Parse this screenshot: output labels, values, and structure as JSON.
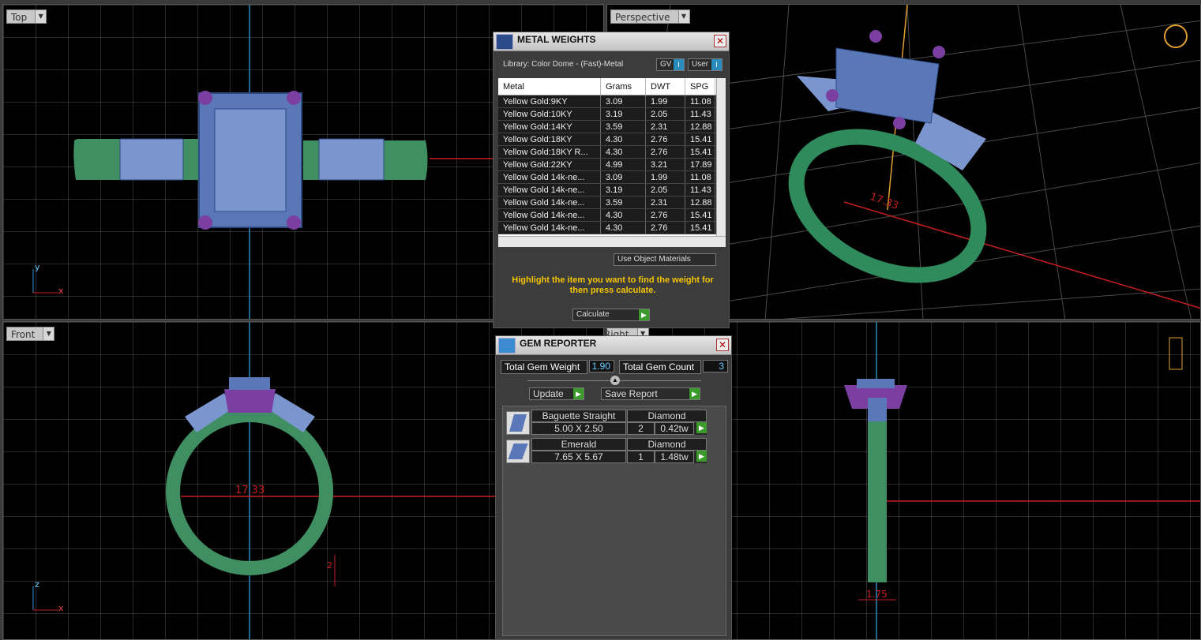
{
  "viewports": {
    "top": {
      "label": "Top",
      "axis_a": "y",
      "axis_b": "x"
    },
    "perspective": {
      "label": "Perspective",
      "dimension": "17.33"
    },
    "front": {
      "label": "Front",
      "axis_a": "z",
      "axis_b": "x",
      "dimension": "17.33",
      "dimension_small": "2"
    },
    "right": {
      "label": "Right",
      "dimension": "1.75"
    }
  },
  "metal_weights": {
    "title": "METAL WEIGHTS",
    "library": "Library: Color Dome - (Fast)-Metal",
    "gv_label": "GV",
    "user_label": "User",
    "columns": [
      "Metal",
      "Grams",
      "DWT",
      "SPG"
    ],
    "rows": [
      [
        "Yellow Gold:9KY",
        "3.09",
        "1.99",
        "11.08"
      ],
      [
        "Yellow Gold:10KY",
        "3.19",
        "2.05",
        "11.43"
      ],
      [
        "Yellow Gold:14KY",
        "3.59",
        "2.31",
        "12.88"
      ],
      [
        "Yellow Gold:18KY",
        "4.30",
        "2.76",
        "15.41"
      ],
      [
        "Yellow Gold:18KY R...",
        "4.30",
        "2.76",
        "15.41"
      ],
      [
        "Yellow Gold:22KY",
        "4.99",
        "3.21",
        "17.89"
      ],
      [
        "Yellow Gold 14k-ne...",
        "3.09",
        "1.99",
        "11.08"
      ],
      [
        "Yellow Gold 14k-ne...",
        "3.19",
        "2.05",
        "11.43"
      ],
      [
        "Yellow Gold 14k-ne...",
        "3.59",
        "2.31",
        "12.88"
      ],
      [
        "Yellow Gold 14k-ne...",
        "4.30",
        "2.76",
        "15.41"
      ],
      [
        "Yellow Gold 14k-ne...",
        "4.30",
        "2.76",
        "15.41"
      ]
    ],
    "use_object_materials": "Use Object Materials",
    "instruction": "Highlight the item you want to find the weight for then press calculate.",
    "calculate": "Calculate"
  },
  "gem_reporter": {
    "title": "GEM REPORTER",
    "total_weight_label": "Total Gem Weight",
    "total_weight": "1.90",
    "total_count_label": "Total Gem Count",
    "total_count": "3",
    "update": "Update",
    "save_report": "Save Report",
    "gems": [
      {
        "shape": "Baguette Straight",
        "material": "Diamond",
        "size": "5.00 X 2.50",
        "qty": "2",
        "weight": "0.42tw"
      },
      {
        "shape": "Emerald",
        "material": "Diamond",
        "size": "7.65 X 5.67",
        "qty": "1",
        "weight": "1.48tw"
      }
    ]
  },
  "colors": {
    "gem": "#6b87c4",
    "metal": "#2f8a5c",
    "prong": "#7a3fa0",
    "axis_red": "#c81e1e",
    "axis_blue": "#2a8bbd"
  }
}
